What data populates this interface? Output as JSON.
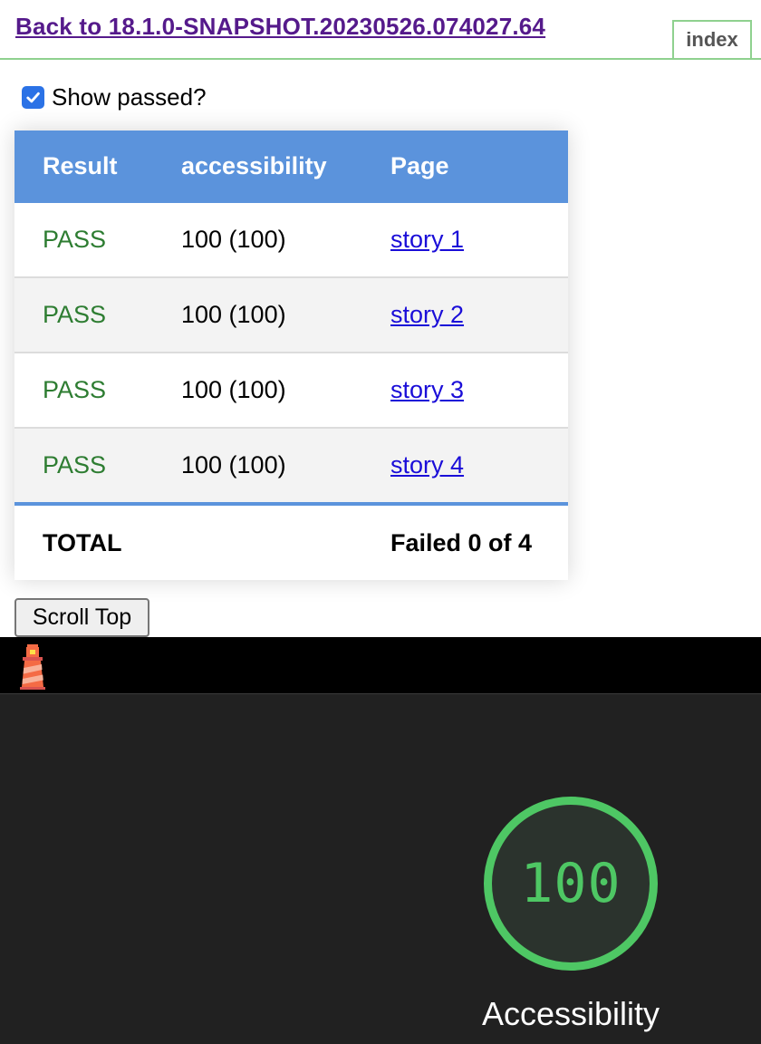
{
  "header": {
    "back_link": "Back to 18.1.0-SNAPSHOT.20230526.074027.64",
    "index_label": "index"
  },
  "filter": {
    "show_passed_label": "Show passed?",
    "show_passed_checked": true
  },
  "table": {
    "columns": [
      "Result",
      "accessibility",
      "Page"
    ],
    "rows": [
      {
        "result": "PASS",
        "accessibility": "100 (100)",
        "page": "story 1"
      },
      {
        "result": "PASS",
        "accessibility": "100 (100)",
        "page": "story 2"
      },
      {
        "result": "PASS",
        "accessibility": "100 (100)",
        "page": "story 3"
      },
      {
        "result": "PASS",
        "accessibility": "100 (100)",
        "page": "story 4"
      }
    ],
    "total_label": "TOTAL",
    "total_summary": "Failed 0 of 4"
  },
  "scroll_top_label": "Scroll Top",
  "lighthouse": {
    "logo_icon": "lighthouse-icon",
    "score": "100",
    "category": "Accessibility",
    "pass_color": "#4ec764"
  },
  "colors": {
    "header_blue": "#5b93dc",
    "pass_green": "#2e7d32",
    "link_blue": "#1a0dd8",
    "visited_purple": "#551a8b"
  }
}
